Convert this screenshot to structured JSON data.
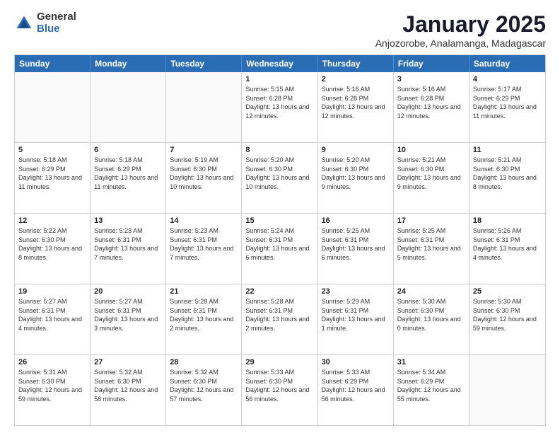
{
  "logo": {
    "general": "General",
    "blue": "Blue"
  },
  "title": "January 2025",
  "subtitle": "Anjozorobe, Analamanga, Madagascar",
  "header_days": [
    "Sunday",
    "Monday",
    "Tuesday",
    "Wednesday",
    "Thursday",
    "Friday",
    "Saturday"
  ],
  "rows": [
    [
      {
        "day": "",
        "text": ""
      },
      {
        "day": "",
        "text": ""
      },
      {
        "day": "",
        "text": ""
      },
      {
        "day": "1",
        "text": "Sunrise: 5:15 AM\nSunset: 6:28 PM\nDaylight: 13 hours and 12 minutes."
      },
      {
        "day": "2",
        "text": "Sunrise: 5:16 AM\nSunset: 6:28 PM\nDaylight: 13 hours and 12 minutes."
      },
      {
        "day": "3",
        "text": "Sunrise: 5:16 AM\nSunset: 6:28 PM\nDaylight: 13 hours and 12 minutes."
      },
      {
        "day": "4",
        "text": "Sunrise: 5:17 AM\nSunset: 6:29 PM\nDaylight: 13 hours and 11 minutes."
      }
    ],
    [
      {
        "day": "5",
        "text": "Sunrise: 5:18 AM\nSunset: 6:29 PM\nDaylight: 13 hours and 11 minutes."
      },
      {
        "day": "6",
        "text": "Sunrise: 5:18 AM\nSunset: 6:29 PM\nDaylight: 13 hours and 11 minutes."
      },
      {
        "day": "7",
        "text": "Sunrise: 5:19 AM\nSunset: 6:30 PM\nDaylight: 13 hours and 10 minutes."
      },
      {
        "day": "8",
        "text": "Sunrise: 5:20 AM\nSunset: 6:30 PM\nDaylight: 13 hours and 10 minutes."
      },
      {
        "day": "9",
        "text": "Sunrise: 5:20 AM\nSunset: 6:30 PM\nDaylight: 13 hours and 9 minutes."
      },
      {
        "day": "10",
        "text": "Sunrise: 5:21 AM\nSunset: 6:30 PM\nDaylight: 13 hours and 9 minutes."
      },
      {
        "day": "11",
        "text": "Sunrise: 5:21 AM\nSunset: 6:30 PM\nDaylight: 13 hours and 8 minutes."
      }
    ],
    [
      {
        "day": "12",
        "text": "Sunrise: 5:22 AM\nSunset: 6:30 PM\nDaylight: 13 hours and 8 minutes."
      },
      {
        "day": "13",
        "text": "Sunrise: 5:23 AM\nSunset: 6:31 PM\nDaylight: 13 hours and 7 minutes."
      },
      {
        "day": "14",
        "text": "Sunrise: 5:23 AM\nSunset: 6:31 PM\nDaylight: 13 hours and 7 minutes."
      },
      {
        "day": "15",
        "text": "Sunrise: 5:24 AM\nSunset: 6:31 PM\nDaylight: 13 hours and 6 minutes."
      },
      {
        "day": "16",
        "text": "Sunrise: 5:25 AM\nSunset: 6:31 PM\nDaylight: 13 hours and 6 minutes."
      },
      {
        "day": "17",
        "text": "Sunrise: 5:25 AM\nSunset: 6:31 PM\nDaylight: 13 hours and 5 minutes."
      },
      {
        "day": "18",
        "text": "Sunrise: 5:26 AM\nSunset: 6:31 PM\nDaylight: 13 hours and 4 minutes."
      }
    ],
    [
      {
        "day": "19",
        "text": "Sunrise: 5:27 AM\nSunset: 6:31 PM\nDaylight: 13 hours and 4 minutes."
      },
      {
        "day": "20",
        "text": "Sunrise: 5:27 AM\nSunset: 6:31 PM\nDaylight: 13 hours and 3 minutes."
      },
      {
        "day": "21",
        "text": "Sunrise: 5:28 AM\nSunset: 6:31 PM\nDaylight: 13 hours and 2 minutes."
      },
      {
        "day": "22",
        "text": "Sunrise: 5:28 AM\nSunset: 6:31 PM\nDaylight: 13 hours and 2 minutes."
      },
      {
        "day": "23",
        "text": "Sunrise: 5:29 AM\nSunset: 6:31 PM\nDaylight: 13 hours and 1 minute."
      },
      {
        "day": "24",
        "text": "Sunrise: 5:30 AM\nSunset: 6:30 PM\nDaylight: 13 hours and 0 minutes."
      },
      {
        "day": "25",
        "text": "Sunrise: 5:30 AM\nSunset: 6:30 PM\nDaylight: 12 hours and 59 minutes."
      }
    ],
    [
      {
        "day": "26",
        "text": "Sunrise: 5:31 AM\nSunset: 6:30 PM\nDaylight: 12 hours and 59 minutes."
      },
      {
        "day": "27",
        "text": "Sunrise: 5:32 AM\nSunset: 6:30 PM\nDaylight: 12 hours and 58 minutes."
      },
      {
        "day": "28",
        "text": "Sunrise: 5:32 AM\nSunset: 6:30 PM\nDaylight: 12 hours and 57 minutes."
      },
      {
        "day": "29",
        "text": "Sunrise: 5:33 AM\nSunset: 6:30 PM\nDaylight: 12 hours and 56 minutes."
      },
      {
        "day": "30",
        "text": "Sunrise: 5:33 AM\nSunset: 6:29 PM\nDaylight: 12 hours and 56 minutes."
      },
      {
        "day": "31",
        "text": "Sunrise: 5:34 AM\nSunset: 6:29 PM\nDaylight: 12 hours and 55 minutes."
      },
      {
        "day": "",
        "text": ""
      }
    ]
  ]
}
